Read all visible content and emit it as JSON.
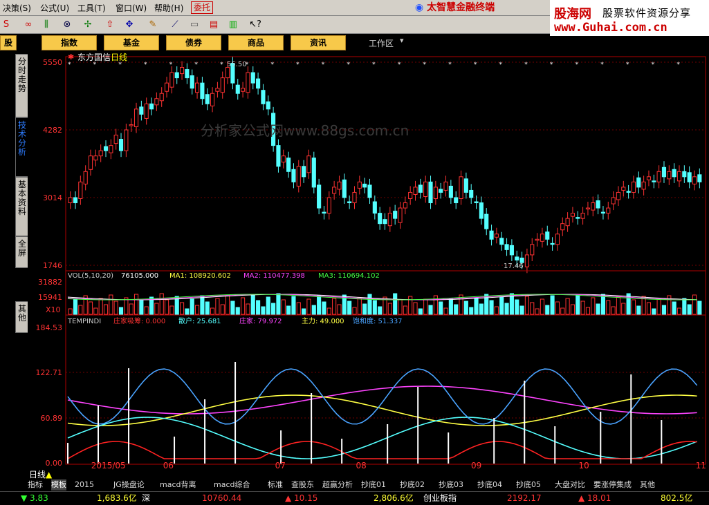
{
  "menu": {
    "items": [
      "决策(S)",
      "公式(U)",
      "工具(T)",
      "窗口(W)",
      "帮助(H)"
    ],
    "weituo": "委托",
    "brand": "太智慧金融终端"
  },
  "logo": {
    "name": "股海网",
    "tagline": "股票软件资源分享",
    "url": "www.Guhai.com.cn"
  },
  "nav": {
    "buttons": [
      "股",
      "指数",
      "基金",
      "债券",
      "商品",
      "资讯"
    ],
    "workspace": "工作区"
  },
  "side_tabs": [
    "分时走势",
    "技术分析",
    "基本资料",
    "全屏",
    "其他"
  ],
  "chart_title": {
    "name": "东方国信",
    "period": "日线"
  },
  "watermark": "分析家公式网www.88gs.com.cn",
  "annotations": {
    "high": "55.50",
    "low": "17.46"
  },
  "vol_header": {
    "label": "VOL(5,10,20)",
    "vol": "76105.000",
    "ma1": "MA1: 108920.602",
    "ma2": "MA2: 110477.398",
    "ma3": "MA3: 110694.102"
  },
  "vol_unit": "X10",
  "ind_header": {
    "label": "TEMPINDI",
    "zhuang_xi": "庄家吸筹: 0.000",
    "sanhu": "散户: 25.681",
    "zhuangjia": "庄家: 79.972",
    "zhuli": "主力: 49.000",
    "baohedu": "饱和度: 51.337"
  },
  "colors": {
    "up": "#ff3232",
    "down": "#54ffff",
    "ma1": "#ffffff",
    "ma2": "#ff44ff",
    "ma3": "#44ff44",
    "bg": "#000000",
    "axis": "#b00000"
  },
  "x_labels": [
    {
      "text": "2015/05",
      "x": 0.04
    },
    {
      "text": "06",
      "x": 0.153
    },
    {
      "text": "07",
      "x": 0.329
    },
    {
      "text": "08",
      "x": 0.456
    },
    {
      "text": "09",
      "x": 0.637
    },
    {
      "text": "10",
      "x": 0.806
    },
    {
      "text": "11",
      "x": 0.99
    }
  ],
  "period_label": "日线",
  "bottom_tabs": [
    "指标",
    "模板",
    "2015",
    "JG操盘论",
    "macd背离",
    "macd综合",
    "标准",
    "查股东",
    "超赢分析",
    "抄底01",
    "抄底02",
    "抄底03",
    "抄底04",
    "抄底05",
    "大盘对比",
    "要涨停集成",
    "其他"
  ],
  "status": [
    {
      "text": "▼ 3.83",
      "color": "#33ff33"
    },
    {
      "text": "1,683.6亿",
      "color": "#ffff33"
    },
    {
      "text": "深",
      "color": "#ffffff"
    },
    {
      "text": "10760.44",
      "color": "#ff3333"
    },
    {
      "text": "▲ 10.15",
      "color": "#ff3333"
    },
    {
      "text": "2,806.6亿",
      "color": "#ffff33"
    },
    {
      "text": "创业板指",
      "color": "#ffffff"
    },
    {
      "text": "2192.17",
      "color": "#ff3333"
    },
    {
      "text": "▲ 18.01",
      "color": "#ff3333"
    },
    {
      "text": "802.5亿",
      "color": "#ffff33"
    }
  ],
  "chart_data": {
    "type": "candlestick",
    "price_axis": [
      "5550",
      "4282",
      "3014",
      "1746"
    ],
    "vol_axis": [
      "31882",
      "15941"
    ],
    "ind_axis": [
      "184.53",
      "122.71",
      "60.89",
      "0.00"
    ],
    "price_range": [
      1746,
      5550
    ],
    "closes": [
      30,
      29,
      33,
      35,
      38,
      38,
      39,
      39,
      40,
      42,
      39,
      43,
      44,
      47,
      46,
      48,
      47,
      49,
      50,
      52,
      54,
      53,
      55,
      53,
      51,
      52,
      49,
      48,
      50,
      51,
      53,
      55,
      52,
      50,
      51,
      54,
      52,
      51,
      48,
      47,
      40,
      36,
      38,
      35,
      33,
      36,
      34,
      38,
      32,
      28,
      27,
      30,
      32,
      33,
      30,
      29,
      31,
      33,
      32,
      30,
      27,
      25,
      25,
      27,
      26,
      28,
      29,
      31,
      32,
      31,
      33,
      29,
      32,
      31,
      33,
      30,
      29,
      34,
      31,
      30,
      29,
      26,
      24,
      22,
      23,
      21,
      20,
      19,
      18,
      17.5,
      19,
      21,
      22,
      23,
      22,
      21,
      23,
      25,
      26,
      27,
      26,
      27,
      28,
      29,
      28,
      27,
      28,
      30,
      31,
      32,
      31,
      33,
      32,
      33,
      34,
      33,
      35,
      34,
      35,
      34,
      35,
      34,
      33,
      34,
      33
    ]
  }
}
